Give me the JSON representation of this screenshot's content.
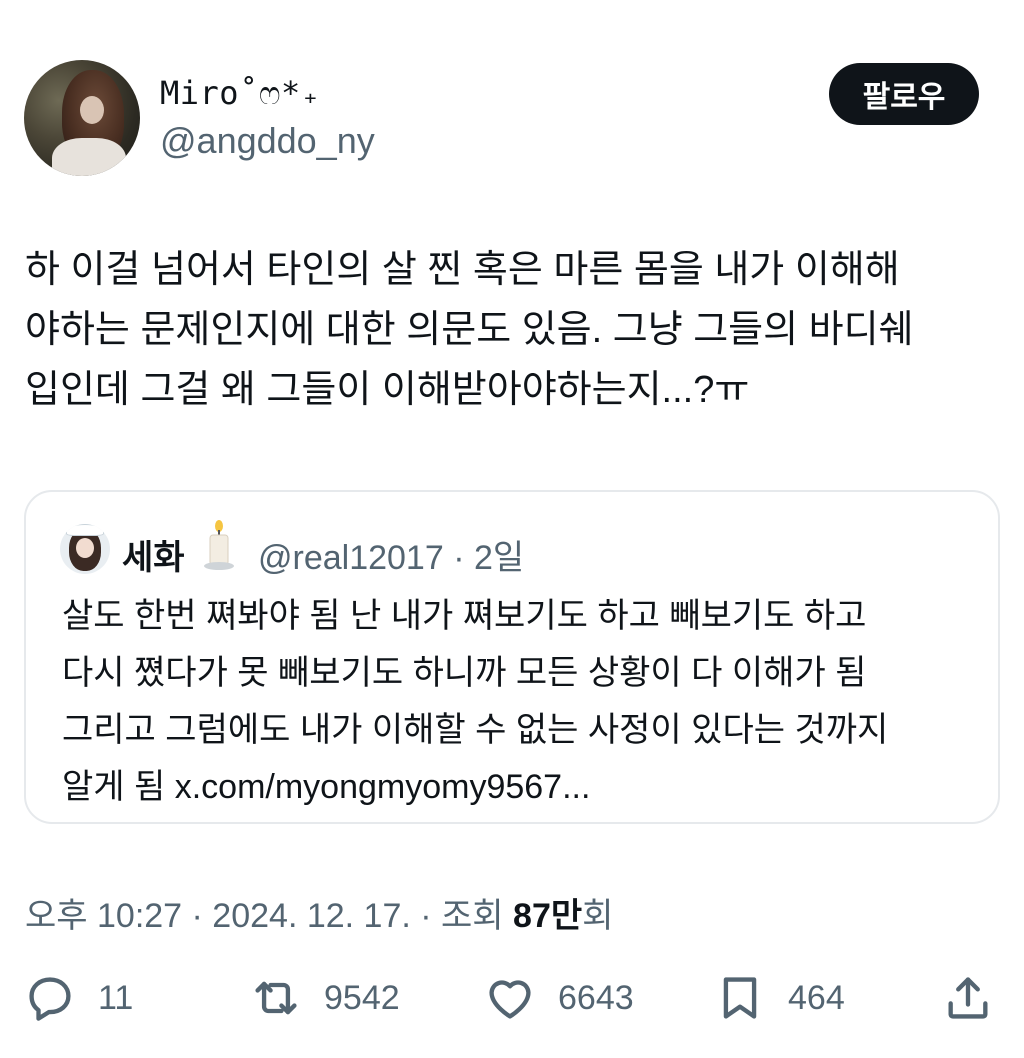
{
  "author": {
    "display_name": "Miro˚ෆ*₊",
    "handle": "@angddo_ny"
  },
  "follow_button": {
    "label": "팔로우"
  },
  "tweet": {
    "text": "하 이걸 넘어서 타인의 살 찐 혹은 마른 몸을 내가 이해해\n야하는 문제인지에 대한 의문도 있음. 그냥 그들의 바디쉐\n입인데 그걸 왜 그들이 이해받아야하는지...?ㅠ"
  },
  "quote": {
    "name": "세화",
    "meta": "@real12017 · 2일",
    "text": "살도 한번 쪄봐야 됨 난 내가 쪄보기도 하고 빼보기도 하고\n다시 쪘다가 못 빼보기도 하니까 모든 상황이 다 이해가 됨\n그리고 그럼에도 내가 이해할 수 없는 사정이 있다는 것까지\n알게 됨 x.com/myongmyomy9567..."
  },
  "meta": {
    "time_date": "오후 10:27 · 2024. 12. 17. · 조회 ",
    "views_number": "87만",
    "views_suffix": "회"
  },
  "actions": {
    "replies": "11",
    "retweets": "9542",
    "likes": "6643",
    "bookmarks": "464"
  },
  "icons": {
    "reply": "reply-icon",
    "retweet": "retweet-icon",
    "like": "heart-icon",
    "bookmark": "bookmark-icon",
    "share": "share-icon"
  },
  "colors": {
    "text": "#0f1419",
    "secondary": "#536471",
    "border": "#e6e9ec",
    "follow_bg": "#0f1419"
  }
}
